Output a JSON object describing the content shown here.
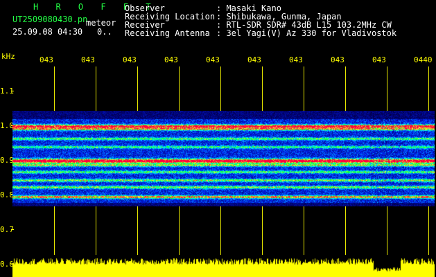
{
  "header": {
    "station_name": "H R O F F T",
    "filename": "UT2509080430.pn",
    "type_label": "meteor",
    "datetime": "25.09.08 04:30",
    "count": "0..",
    "fields": [
      {
        "label": "Observer",
        "value": ": Masaki Kano"
      },
      {
        "label": "Receiving Location",
        "value": ": Shibukawa, Gunma, Japan"
      },
      {
        "label": "Receiver",
        "value": ": RTL-SDR SDR# 43dB L15 103.2MHz CW"
      },
      {
        "label": "Receiving Antenna",
        "value": ": 3el Yagi(V) Az 330 for Vladivostok"
      }
    ]
  },
  "axis": {
    "unit": "kHz",
    "time_ticks": [
      "043",
      "043",
      "043",
      "043",
      "043",
      "043",
      "043",
      "043",
      "043",
      "0440"
    ],
    "freq_ticks": [
      "1.1",
      "1.0",
      "0.9",
      "0.8",
      "0.7",
      "0.6"
    ]
  },
  "colors": {
    "text_green": "#22ff44",
    "text_white": "#ffffff",
    "axis_yellow": "#ffff00",
    "background": "#000000"
  }
}
